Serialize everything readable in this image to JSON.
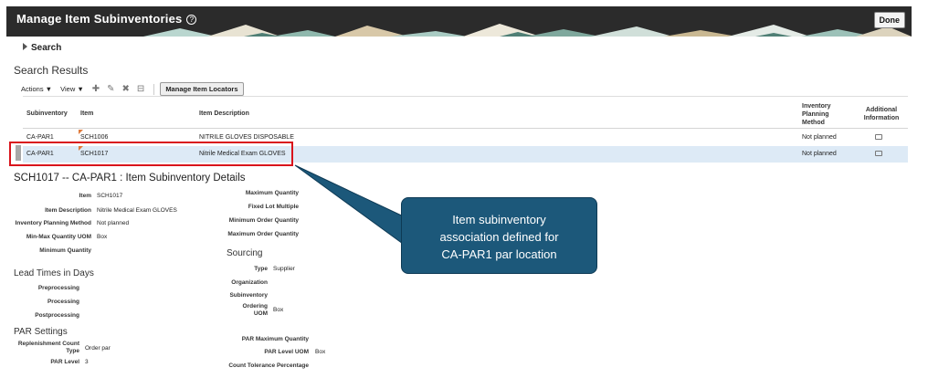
{
  "header": {
    "title": "Manage Item Subinventories",
    "help_icon": "question-circle-icon",
    "done_label": "Done"
  },
  "search": {
    "label": "Search",
    "icon": "triangle-right-icon"
  },
  "results": {
    "title": "Search Results",
    "toolbar": {
      "actions_label": "Actions ▼",
      "view_label": "View ▼",
      "icons": [
        "plus-icon",
        "pencil-icon",
        "x-icon",
        "detach-icon"
      ],
      "manage_locators_label": "Manage Item Locators"
    },
    "columns": {
      "subinventory": "Subinventory",
      "item": "Item",
      "description": "Item Description",
      "planning_line1": "Inventory",
      "planning_line2": "Planning",
      "planning_line3": "Method",
      "additional_line1": "Additional",
      "additional_line2": "Information"
    },
    "rows": [
      {
        "subinventory": "CA-PAR1",
        "item": "SCH1006",
        "description": "NITRILE GLOVES DISPOSABLE",
        "planning": "Not planned"
      },
      {
        "subinventory": "CA-PAR1",
        "item": "SCH1017",
        "description": "Nitrile Medical Exam GLOVES",
        "planning": "Not planned"
      }
    ]
  },
  "details": {
    "title": "SCH1017 -- CA-PAR1 : Item Subinventory Details",
    "item_label": "Item",
    "item_value": "SCH1017",
    "desc_label": "Item Description",
    "desc_value": "Nitrile Medical Exam GLOVES",
    "ipm_label": "Inventory Planning Method",
    "ipm_value": "Not planned",
    "minmax_uom_label": "Min-Max Quantity UOM",
    "minmax_uom_value": "Box",
    "min_qty_label": "Minimum Quantity",
    "max_qty_label": "Maximum Quantity",
    "fixed_lot_label": "Fixed Lot Multiple",
    "min_order_label": "Minimum Order Quantity",
    "max_order_label": "Maximum Order Quantity",
    "sourcing_title": "Sourcing",
    "type_label": "Type",
    "type_value": "Supplier",
    "org_label": "Organization",
    "subinv_label": "Subinventory",
    "ordering_uom_line1": "Ordering",
    "ordering_uom_line2": "UOM",
    "ordering_uom_value": "Box",
    "lead_title": "Lead Times in Days",
    "preprocessing_label": "Preprocessing",
    "processing_label": "Processing",
    "postprocessing_label": "Postprocessing",
    "par_title": "PAR Settings",
    "repl_count_line1": "Replenishment Count",
    "repl_count_line2": "Type",
    "repl_count_value": "Order par",
    "par_level_label": "PAR Level",
    "par_level_value": "3",
    "par_max_label": "PAR Maximum Quantity",
    "par_uom_label": "PAR Level UOM",
    "par_uom_value": "Box",
    "count_tol_label": "Count Tolerance Percentage"
  },
  "callout": {
    "line1": "Item subinventory",
    "line2": "association defined for",
    "line3": "CA-PAR1 par location"
  },
  "colors": {
    "header_bg": "#2b2b2b",
    "selected_row": "#ddeaf6",
    "highlight_border": "#d9141c",
    "callout_bg": "#1c587a"
  }
}
